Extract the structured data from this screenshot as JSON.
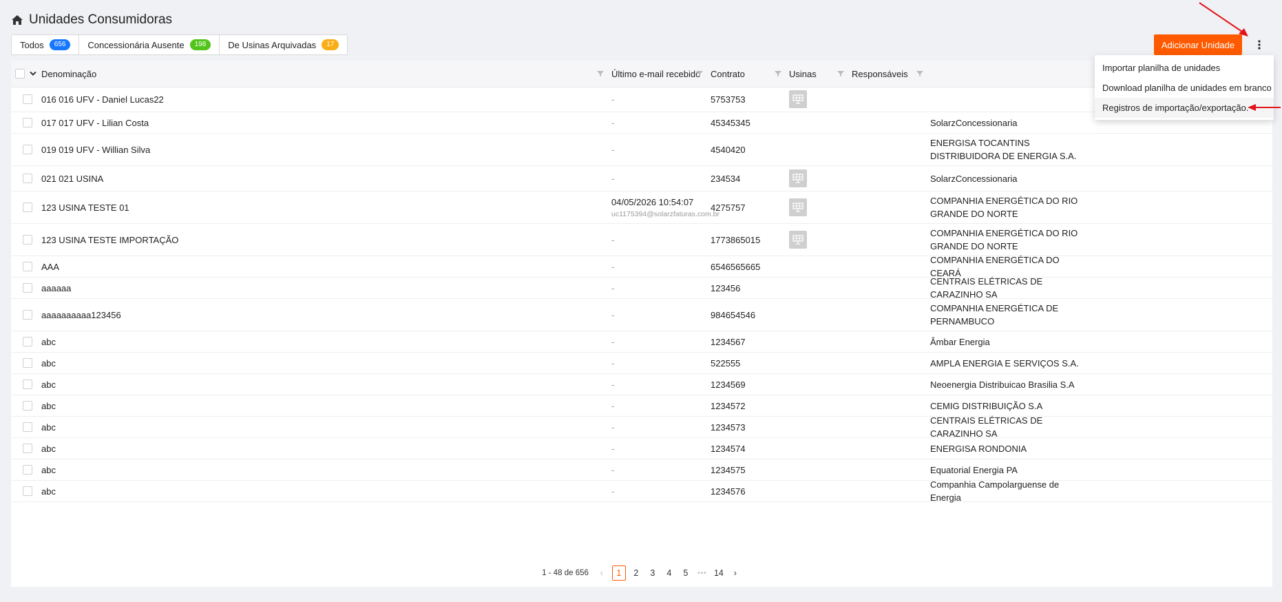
{
  "page": {
    "title": "Unidades Consumidoras"
  },
  "tabs": [
    {
      "label": "Todos",
      "count": "656",
      "color": "#1677ff"
    },
    {
      "label": "Concessionária Ausente",
      "count": "198",
      "color": "#52c41a"
    },
    {
      "label": "De Usinas Arquivadas",
      "count": "17",
      "color": "#faad14"
    }
  ],
  "actions": {
    "add_label": "Adicionar Unidade",
    "accent": "#ff5a00"
  },
  "menu": {
    "items": [
      "Importar planilha de unidades",
      "Download planilha de unidades em branco",
      "Registros de importação/exportação."
    ]
  },
  "table": {
    "columns": [
      "Denominação",
      "Último e-mail recebido",
      "Contrato",
      "Usinas",
      "Responsáveis"
    ],
    "rows": [
      {
        "name": "016 016 UFV - Daniel Lucas22",
        "email_date": "-",
        "email_addr": "",
        "contract": "5753753",
        "usina_icon": "solar-panel-icon",
        "concessionaria": ""
      },
      {
        "name": "017 017 UFV - Lilian Costa",
        "email_date": "-",
        "email_addr": "",
        "contract": "45345345",
        "usina_icon": "",
        "concessionaria": "SolarzConcessionaria"
      },
      {
        "name": "019 019 UFV - Willian Silva",
        "email_date": "-",
        "email_addr": "",
        "contract": "4540420",
        "usina_icon": "",
        "concessionaria": "ENERGISA TOCANTINS DISTRIBUIDORA DE ENERGIA S.A."
      },
      {
        "name": "021 021 USINA",
        "email_date": "-",
        "email_addr": "",
        "contract": "234534",
        "usina_icon": "solar-panel-icon",
        "concessionaria": "SolarzConcessionaria"
      },
      {
        "name": "123 USINA TESTE 01",
        "email_date": "04/05/2026 10:54:07",
        "email_addr": "uc1175394@solarzfaturas.com.br",
        "contract": "4275757",
        "usina_icon": "solar-panel-icon",
        "concessionaria": "COMPANHIA ENERGÉTICA DO RIO GRANDE DO NORTE"
      },
      {
        "name": "123 USINA TESTE IMPORTAÇÃO",
        "email_date": "-",
        "email_addr": "",
        "contract": "1773865015",
        "usina_icon": "solar-panel-icon",
        "concessionaria": "COMPANHIA ENERGÉTICA DO RIO GRANDE DO NORTE"
      },
      {
        "name": "AAA",
        "email_date": "-",
        "email_addr": "",
        "contract": "6546565665",
        "usina_icon": "",
        "concessionaria": "COMPANHIA ENERGÉTICA DO CEARÁ"
      },
      {
        "name": "aaaaaa",
        "email_date": "-",
        "email_addr": "",
        "contract": "123456",
        "usina_icon": "",
        "concessionaria": "CENTRAIS ELÉTRICAS DE CARAZINHO SA"
      },
      {
        "name": "aaaaaaaaaa123456",
        "email_date": "-",
        "email_addr": "",
        "contract": "984654546",
        "usina_icon": "",
        "concessionaria": "COMPANHIA ENERGÉTICA DE PERNAMBUCO"
      },
      {
        "name": "abc",
        "email_date": "-",
        "email_addr": "",
        "contract": "1234567",
        "usina_icon": "",
        "concessionaria": "Âmbar Energia"
      },
      {
        "name": "abc",
        "email_date": "-",
        "email_addr": "",
        "contract": "522555",
        "usina_icon": "",
        "concessionaria": "AMPLA ENERGIA E SERVIÇOS S.A."
      },
      {
        "name": "abc",
        "email_date": "-",
        "email_addr": "",
        "contract": "1234569",
        "usina_icon": "",
        "concessionaria": "Neoenergia Distribuicao Brasilia S.A"
      },
      {
        "name": "abc",
        "email_date": "-",
        "email_addr": "",
        "contract": "1234572",
        "usina_icon": "",
        "concessionaria": "CEMIG DISTRIBUIÇÃO S.A"
      },
      {
        "name": "abc",
        "email_date": "-",
        "email_addr": "",
        "contract": "1234573",
        "usina_icon": "",
        "concessionaria": "CENTRAIS ELÉTRICAS DE CARAZINHO SA"
      },
      {
        "name": "abc",
        "email_date": "-",
        "email_addr": "",
        "contract": "1234574",
        "usina_icon": "",
        "concessionaria": "ENERGISA RONDONIA"
      },
      {
        "name": "abc",
        "email_date": "-",
        "email_addr": "",
        "contract": "1234575",
        "usina_icon": "",
        "concessionaria": "Equatorial Energia PA"
      },
      {
        "name": "abc",
        "email_date": "-",
        "email_addr": "",
        "contract": "1234576",
        "usina_icon": "",
        "concessionaria": "Companhia Campolarguense de Energia"
      }
    ]
  },
  "pagination": {
    "summary": "1 - 48 de 656",
    "pages": [
      "1",
      "2",
      "3",
      "4",
      "5"
    ],
    "ellipsis": "•••",
    "last_page": "14",
    "current": "1"
  }
}
